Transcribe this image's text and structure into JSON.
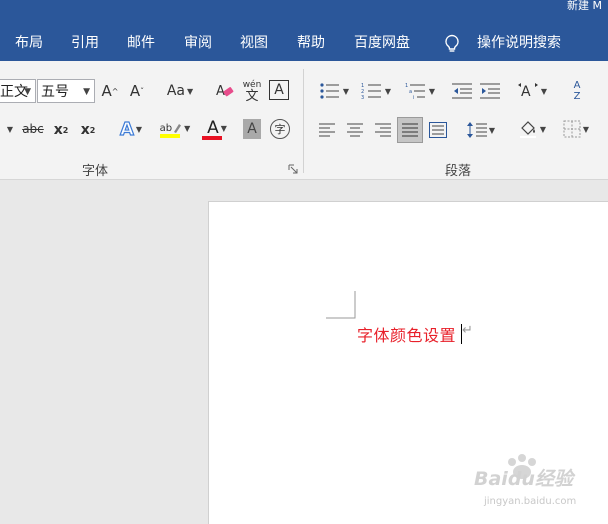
{
  "window": {
    "title": "新建 M"
  },
  "tabs": [
    {
      "label": "布局"
    },
    {
      "label": "引用"
    },
    {
      "label": "邮件"
    },
    {
      "label": "审阅"
    },
    {
      "label": "视图"
    },
    {
      "label": "帮助"
    },
    {
      "label": "百度网盘"
    }
  ],
  "tell_me": {
    "label": "操作说明搜索",
    "icon": "lightbulb-icon"
  },
  "font_group": {
    "label": "字体",
    "font_name": "正文",
    "font_size": "五号",
    "change_case": "Aa",
    "strikethrough": "abc",
    "subscript": "x",
    "subscript_mark": "2",
    "superscript": "x",
    "superscript_mark": "2",
    "highlight_label": "ab",
    "highlight_color": "#ffff00",
    "font_color_label": "A",
    "font_color": "#e81123",
    "phonetic_top": "wén",
    "phonetic_bottom": "文",
    "char_border": "A",
    "char_shading": "A",
    "enclose_char": "字",
    "sort_top": "A",
    "sort_bottom": "Z",
    "grow_font": "A",
    "shrink_font": "A",
    "text_effects": "A"
  },
  "paragraph_group": {
    "label": "段落"
  },
  "document": {
    "text": "字体颜色设置",
    "text_color": "#e8202a",
    "para_mark": "↵"
  },
  "watermark": {
    "text": "Baidu经验",
    "url": "jingyan.baidu.com"
  }
}
